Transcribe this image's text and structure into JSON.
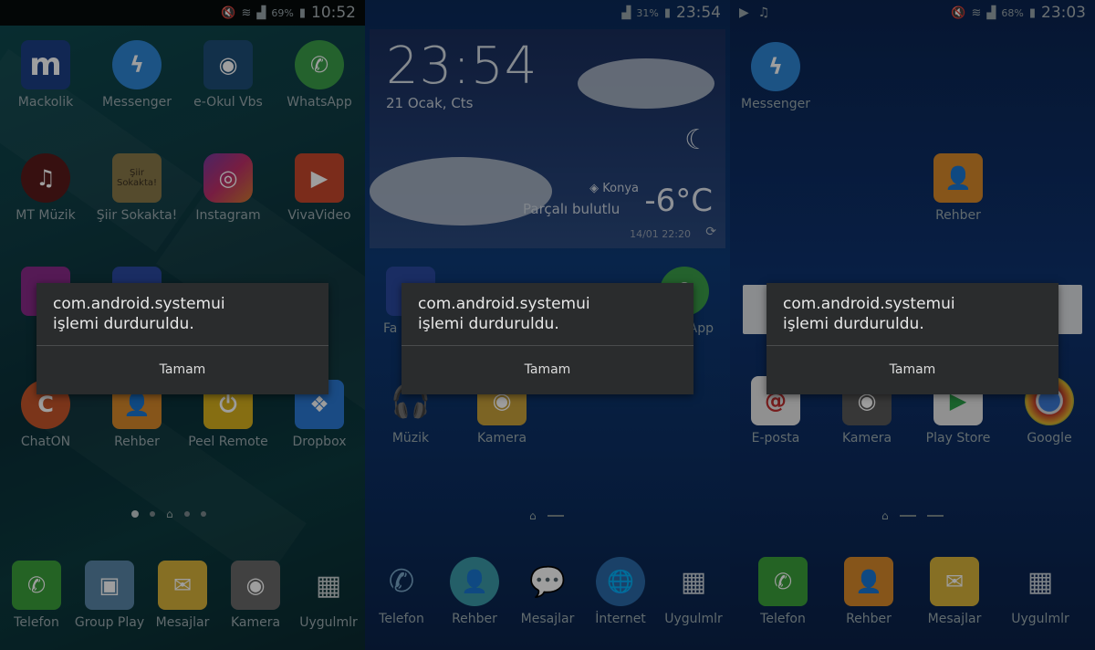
{
  "phone1": {
    "status": {
      "battery": "69%",
      "time": "10:52"
    },
    "apps": [
      "Mackolik",
      "Messenger",
      "e-Okul Vbs",
      "WhatsApp",
      "MT Müzik",
      "Şiir Sokakta!",
      "Instagram",
      "VivaVideo",
      "ChatON",
      "Rehber",
      "Peel Remote",
      "Dropbox"
    ],
    "app_icon_text": {
      "mackolik": "m",
      "siir": "Şiir Sokakta!"
    },
    "dock": [
      "Telefon",
      "Group Play",
      "Mesajlar",
      "Kamera",
      "Uygulmlr"
    ],
    "dialog": {
      "line1": "com.android.systemui",
      "line2": "işlemi durduruldu.",
      "button": "Tamam"
    }
  },
  "phone2": {
    "status": {
      "battery": "31%",
      "time": "23:54"
    },
    "widget": {
      "time": "23:54",
      "date": "21 Ocak, Cts",
      "city": "Konya",
      "condition": "Parçalı bulutlu",
      "temp": "-6°C",
      "updated": "14/01 22:20"
    },
    "apps": [
      "Fa",
      "App",
      "Müzik",
      "Kamera"
    ],
    "dock": [
      "Telefon",
      "Rehber",
      "Mesajlar",
      "İnternet",
      "Uygulmlr"
    ],
    "dialog": {
      "line1": "com.android.systemui",
      "line2": "işlemi durduruldu.",
      "button": "Tamam"
    }
  },
  "phone3": {
    "status": {
      "battery": "68%",
      "time": "23:03"
    },
    "apps": [
      "Messenger",
      "Rehber",
      "E-posta",
      "Kamera",
      "Play Store",
      "Google"
    ],
    "dock": [
      "Telefon",
      "Rehber",
      "Mesajlar",
      "Uygulmlr"
    ],
    "dialog": {
      "line1": "com.android.systemui",
      "line2": "işlemi durduruldu.",
      "button": "Tamam"
    }
  },
  "colors": {
    "dialog_bg": "#2a2c2d",
    "label": "#9cabb0"
  }
}
